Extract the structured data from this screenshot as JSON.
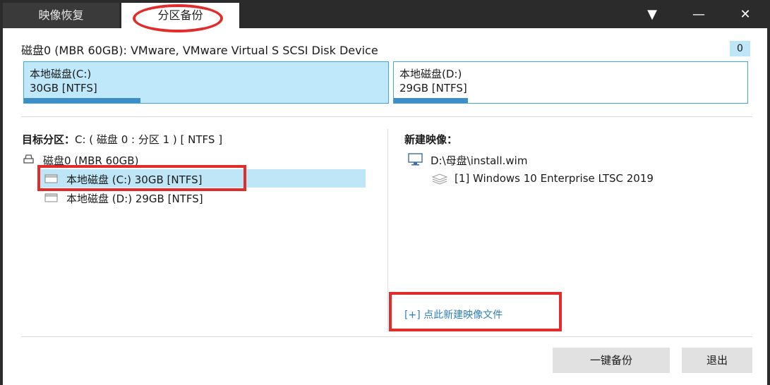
{
  "tabs": [
    {
      "label": "映像恢复",
      "active": false
    },
    {
      "label": "分区备份",
      "active": true
    }
  ],
  "window_controls": {
    "menu": "▼",
    "minimize": "—",
    "close": "✕"
  },
  "disk": {
    "label": "磁盘0 (MBR 60GB): VMware, VMware Virtual S SCSI Disk Device",
    "badge": "0",
    "partitions": [
      {
        "name": "本地磁盘(C:)",
        "size": "30GB [NTFS]",
        "usage": 0.32,
        "selected": true
      },
      {
        "name": "本地磁盘(D:)",
        "size": "29GB [NTFS]",
        "usage": 0.21,
        "selected": false
      }
    ]
  },
  "target": {
    "title": "目标分区：",
    "value": "C: ( 磁盘 0 : 分区 1 ) [ NTFS ]",
    "tree_root": "磁盘0 (MBR 60GB)",
    "tree_items": [
      "本地磁盘 (C:) 30GB [NTFS]",
      "本地磁盘 (D:) 29GB [NTFS]"
    ]
  },
  "new_image": {
    "title": "新建映像：",
    "file": "D:\\母盘\\install.wim",
    "entry": "[1] Windows 10 Enterprise LTSC 2019",
    "add_link": "[+] 点此新建映像文件"
  },
  "buttons": {
    "backup": "一键备份",
    "exit": "退出"
  },
  "colors": {
    "accent": "#3c8ec8",
    "selection": "#bfe6f7",
    "highlight": "#e22b2b"
  }
}
